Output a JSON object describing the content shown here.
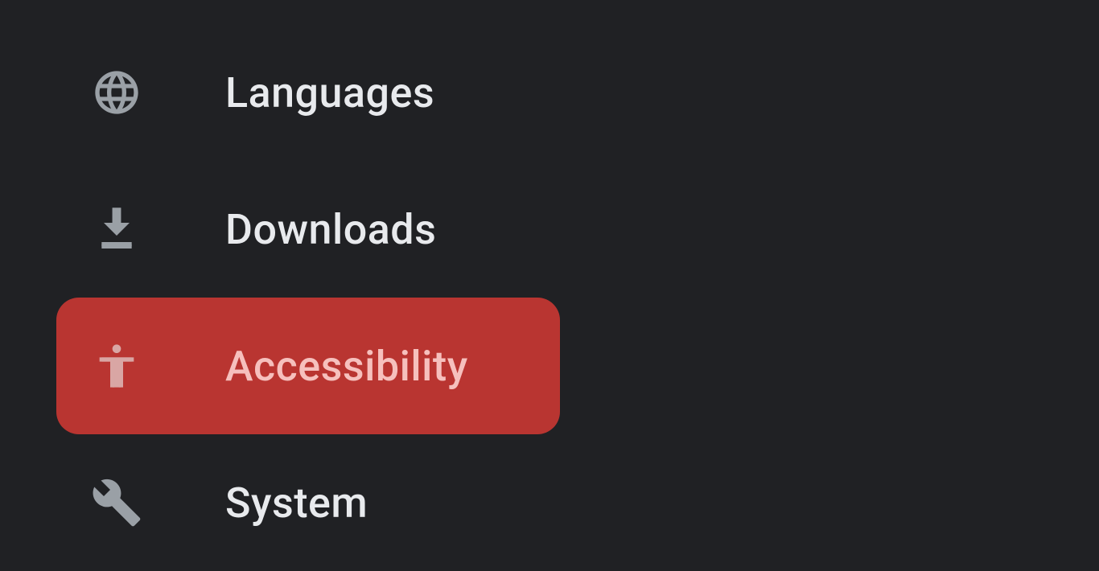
{
  "sidebar": {
    "items": [
      {
        "label": "Languages",
        "icon": "globe"
      },
      {
        "label": "Downloads",
        "icon": "download"
      },
      {
        "label": "Accessibility",
        "icon": "accessibility",
        "highlighted": true
      },
      {
        "label": "System",
        "icon": "wrench"
      }
    ]
  },
  "colors": {
    "background": "#202124",
    "text": "#e8eaed",
    "icon": "#9aa0a6",
    "highlight_bg": "#b93531",
    "highlight_text": "#f6c0bd"
  }
}
